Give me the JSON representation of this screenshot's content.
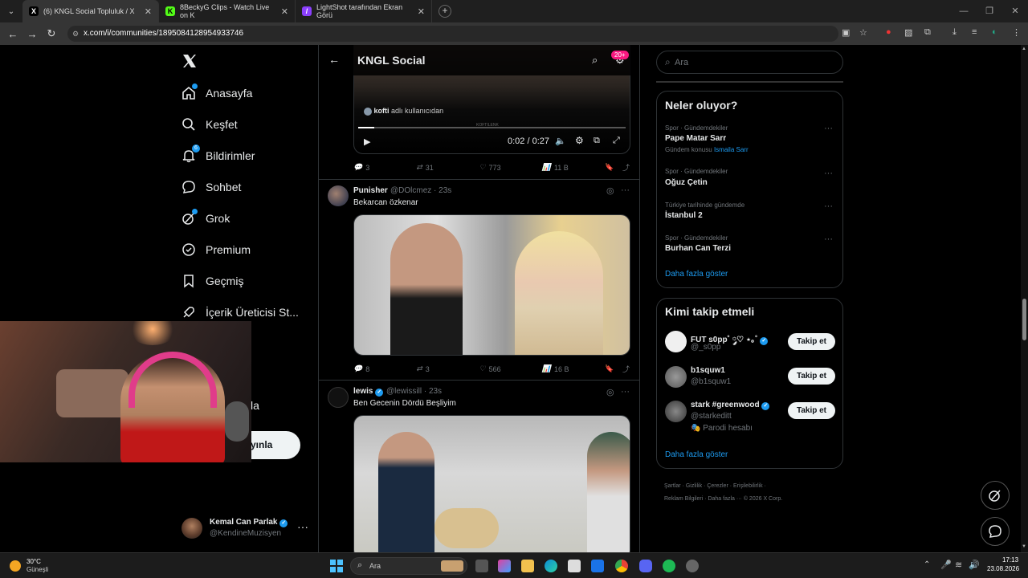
{
  "browser": {
    "tabs": [
      {
        "title": "(6) KNGL Social Topluluk / X",
        "fav": "X",
        "color": "#000000"
      },
      {
        "title": "8BeckyG Clips - Watch Live on K",
        "fav": "K",
        "color": "#53fc18"
      },
      {
        "title": "LightShot tarafından Ekran Görü",
        "fav": "/",
        "color": "#8a3ffc"
      }
    ],
    "url": "x.com/i/communities/1895084128954933746"
  },
  "nav": {
    "items": [
      {
        "label": "Anasayfa"
      },
      {
        "label": "Keşfet"
      },
      {
        "label": "Bildirimler"
      },
      {
        "label": "Sohbet"
      },
      {
        "label": "Grok"
      },
      {
        "label": "Premium"
      },
      {
        "label": "Geçmiş"
      },
      {
        "label": "İçerik Üreticisi St..."
      },
      {
        "label": "r"
      },
      {
        "label": "la"
      }
    ],
    "notif_badge": "6",
    "post_button_label": "yınla",
    "profile": {
      "name": "Kemal Can Parlak",
      "handle": "@KendineMuzisyen"
    }
  },
  "header": {
    "title": "KNGL Social",
    "badge": "20+"
  },
  "posts": [
    {
      "attribution_name": "kofti",
      "attribution_text": "adlı kullanıcıdan",
      "watermark": "KOFTILENK",
      "time": "0:02 / 0:27",
      "replies": "3",
      "reposts": "31",
      "likes": "773",
      "views": "11 B"
    },
    {
      "name": "Punisher",
      "handle": "@DOlcmez",
      "time": "23s",
      "text": "Bekarcan özkenar",
      "replies": "8",
      "reposts": "3",
      "likes": "566",
      "views": "16 B"
    },
    {
      "name": "lewis",
      "handle": "@lewissill",
      "time": "23s",
      "text": "Ben Gecenin Dördü Beşliyim"
    }
  ],
  "search": {
    "placeholder": "Ara"
  },
  "trends": {
    "title": "Neler oluyor?",
    "items": [
      {
        "cat": "Spor · Gündemdekiler",
        "name": "Pape Matar Sarr",
        "extra_prefix": "Gündem konusu",
        "extra_link": "Ismaila Sarr"
      },
      {
        "cat": "Spor · Gündemdekiler",
        "name": "Oğuz Çetin"
      },
      {
        "cat": "Türkiye tarihinde gündemde",
        "name": "İstanbul 2"
      },
      {
        "cat": "Spor · Gündemdekiler",
        "name": "Burhan Can Terzi"
      }
    ],
    "more": "Daha fazla göster"
  },
  "who_to_follow": {
    "title": "Kimi takip etmeli",
    "users": [
      {
        "name": "FUT s0pp˚ ༘♡ ⋆｡˚",
        "handle": "@_s0pp",
        "verified": true
      },
      {
        "name": "b1squw1",
        "handle": "@b1squw1",
        "verified": false
      },
      {
        "name": "stark #greenwood",
        "handle": "@starkeditt",
        "verified": true,
        "note": "Parodi hesabı"
      }
    ],
    "follow_label": "Takip et",
    "more": "Daha fazla göster"
  },
  "footer": {
    "links": [
      "Şartlar",
      "Gizlilik",
      "Çerezler",
      "Erişilebilirlik",
      "Reklam Bilgileri",
      "Daha fazla ···",
      "© 2026 X Corp."
    ]
  },
  "taskbar": {
    "weather_temp": "30°C",
    "weather_desc": "Güneşli",
    "search_label": "Ara",
    "time": "17:13",
    "date": "23.08.2026"
  }
}
